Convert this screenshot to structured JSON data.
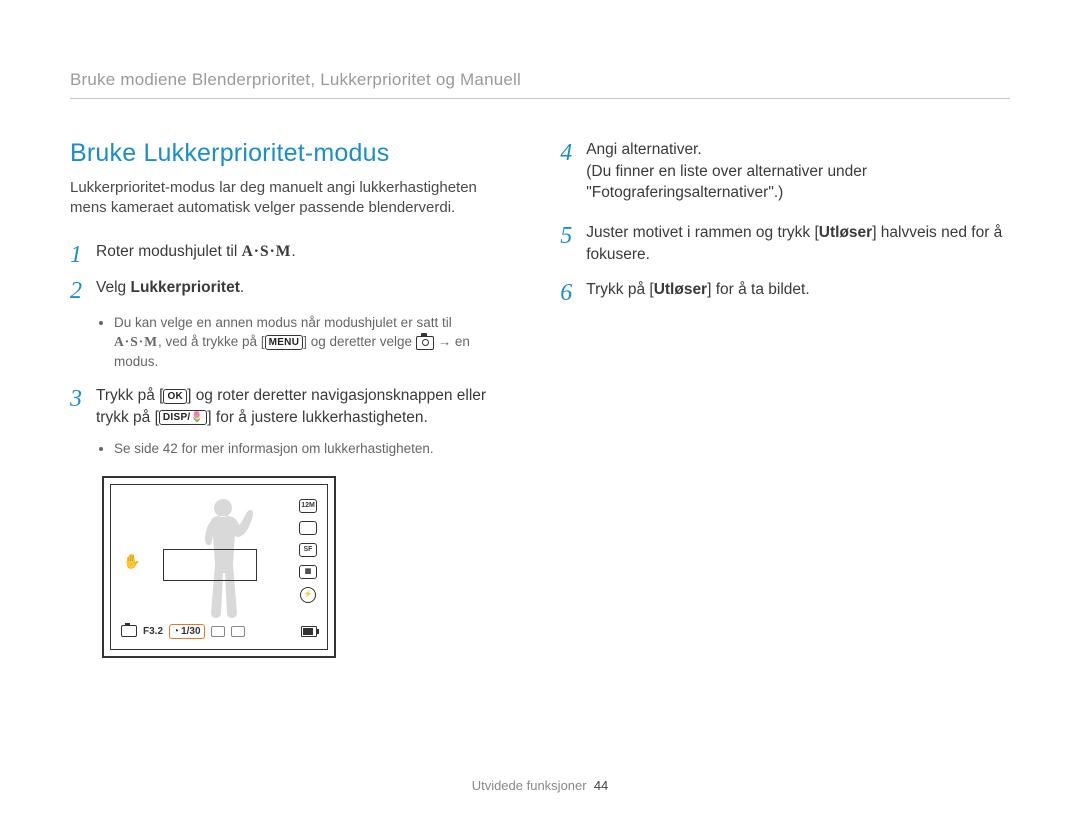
{
  "breadcrumb": "Bruke modiene Blenderprioritet, Lukkerprioritet og Manuell",
  "title": "Bruke Lukkerprioritet-modus",
  "intro": "Lukkerprioritet-modus lar deg manuelt angi lukkerhastigheten mens kameraet automatisk velger passende blenderverdi.",
  "icons": {
    "asm": "A·S·M",
    "menu": "MENU",
    "ok": "OK",
    "disp_macro": "DISP/",
    "arrow": "→"
  },
  "left_steps": {
    "s1": {
      "num": "1",
      "text_a": "Roter modushjulet til ",
      "text_b": "."
    },
    "s2": {
      "num": "2",
      "text_a": "Velg ",
      "bold": "Lukkerprioritet",
      "text_b": ".",
      "sub_a": "Du kan velge en annen modus når modushjulet er satt til ",
      "sub_b": ", ved å trykke på [",
      "sub_c": "] og deretter velge ",
      "sub_d": " en modus."
    },
    "s3": {
      "num": "3",
      "text_a": "Trykk på [",
      "text_b": "] og roter deretter navigasjonsknappen eller trykk på [",
      "text_c": "] for å justere lukkerhastigheten.",
      "sub": "Se side 42 for mer informasjon om lukkerhastigheten."
    }
  },
  "right_steps": {
    "s4": {
      "num": "4",
      "line1": "Angi alternativer.",
      "line2": "(Du finner en liste over alternativer under \"Fotograferingsalternativer\".)"
    },
    "s5": {
      "num": "5",
      "text_a": "Juster motivet i rammen og trykk [",
      "bold": "Utløser",
      "text_b": "] halvveis ned for å fokusere."
    },
    "s6": {
      "num": "6",
      "text_a": "Trykk på [",
      "bold": "Utløser",
      "text_b": "] for å ta bildet."
    }
  },
  "lcd": {
    "aperture": "F3.2",
    "shutter": "1/30",
    "resolution_badge": "12M"
  },
  "footer": {
    "section": "Utvidede funksjoner",
    "page": "44"
  }
}
